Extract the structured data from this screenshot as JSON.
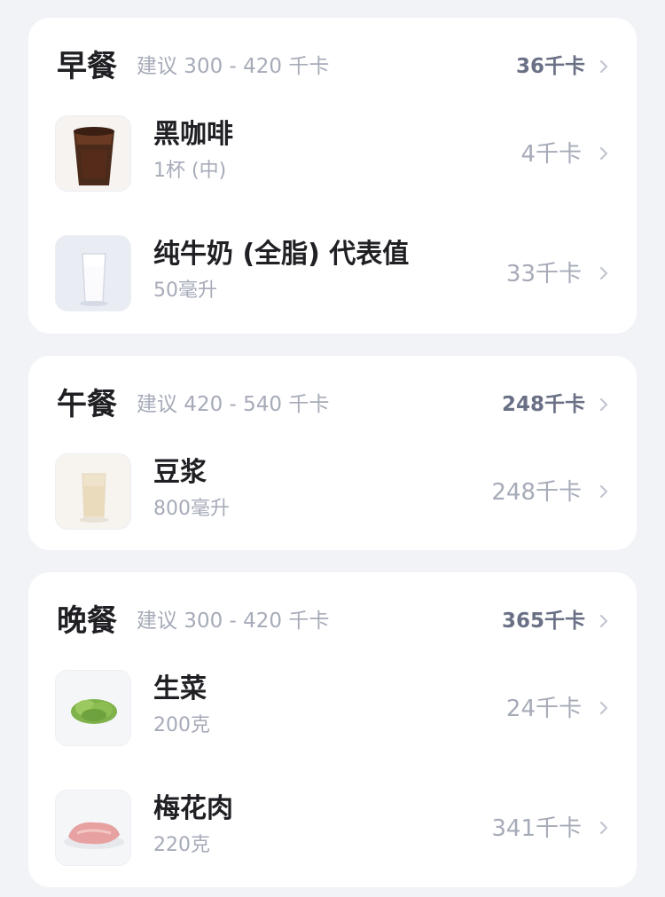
{
  "meals": [
    {
      "title": "早餐",
      "suggestion": "建议 300 - 420 千卡",
      "total": "36千卡",
      "items": [
        {
          "name": "黑咖啡",
          "amount": "1杯 (中)",
          "calories": "4千卡",
          "icon": "coffee-icon"
        },
        {
          "name": "纯牛奶 (全脂) 代表值",
          "amount": "50毫升",
          "calories": "33千卡",
          "icon": "milk-glass-icon"
        }
      ]
    },
    {
      "title": "午餐",
      "suggestion": "建议 420 - 540 千卡",
      "total": "248千卡",
      "items": [
        {
          "name": "豆浆",
          "amount": "800毫升",
          "calories": "248千卡",
          "icon": "soy-milk-icon"
        }
      ]
    },
    {
      "title": "晚餐",
      "suggestion": "建议 300 - 420 千卡",
      "total": "365千卡",
      "items": [
        {
          "name": "生菜",
          "amount": "200克",
          "calories": "24千卡",
          "icon": "lettuce-icon"
        },
        {
          "name": "梅花肉",
          "amount": "220克",
          "calories": "341千卡",
          "icon": "pork-icon"
        }
      ]
    }
  ],
  "colors": {
    "background": "#f2f3f7",
    "card": "#ffffff",
    "title": "#1f1f24",
    "muted": "#a6abb8",
    "total": "#6a7085"
  }
}
